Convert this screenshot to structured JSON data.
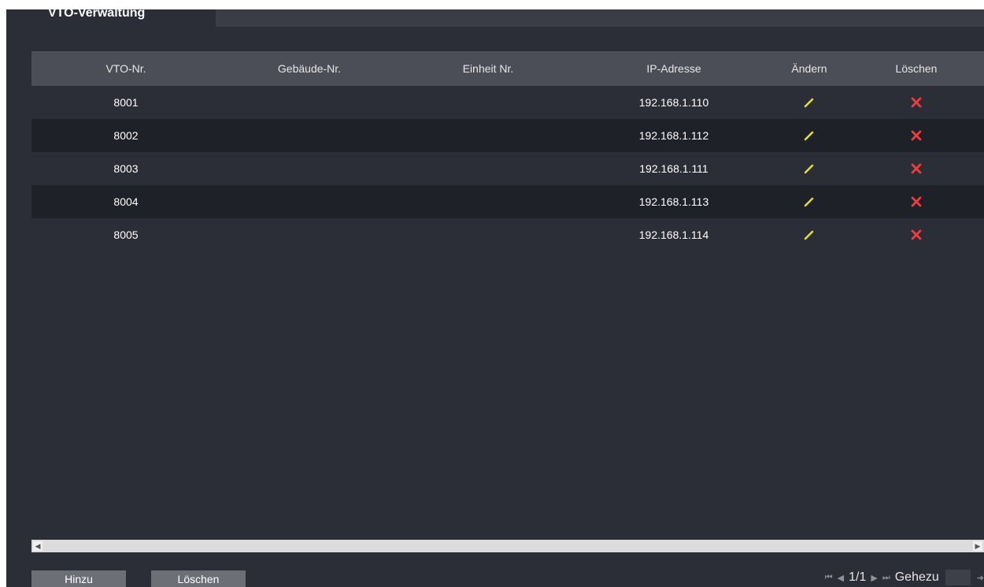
{
  "tab": {
    "title": "VTO-Verwaltung"
  },
  "table": {
    "columns": [
      "VTO-Nr.",
      "Gebäude-Nr.",
      "Einheit Nr.",
      "IP-Adresse",
      "Ändern",
      "Löschen"
    ],
    "rows": [
      {
        "vto": "8001",
        "building": "",
        "unit": "",
        "ip": "192.168.1.110"
      },
      {
        "vto": "8002",
        "building": "",
        "unit": "",
        "ip": "192.168.1.112"
      },
      {
        "vto": "8003",
        "building": "",
        "unit": "",
        "ip": "192.168.1.111"
      },
      {
        "vto": "8004",
        "building": "",
        "unit": "",
        "ip": "192.168.1.113"
      },
      {
        "vto": "8005",
        "building": "",
        "unit": "",
        "ip": "192.168.1.114"
      }
    ]
  },
  "buttons": {
    "add": "Hinzu",
    "delete": "Löschen"
  },
  "pager": {
    "page": "1/1",
    "goto_label": "Gehezu"
  },
  "colors": {
    "background": "#2b2e36",
    "header": "#4b4e56",
    "edit_icon": "#e8e13a",
    "delete_icon": "#f03c3c"
  }
}
